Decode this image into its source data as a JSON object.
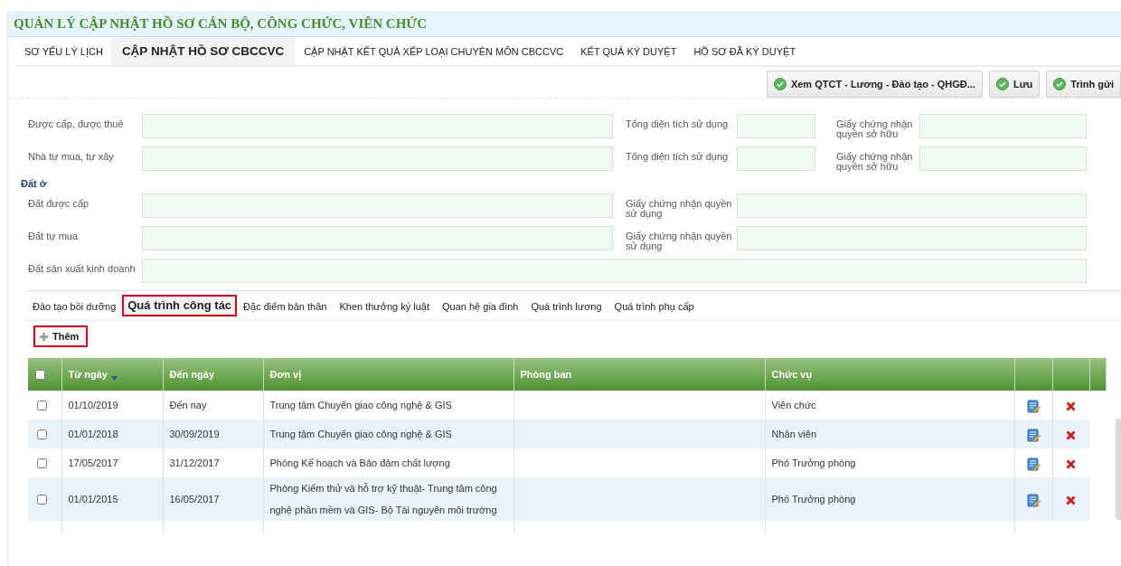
{
  "title": "QUẢN LÝ CẬP NHẬT HỒ SƠ CÁN BỘ, CÔNG CHỨC, VIÊN CHỨC",
  "tabs": [
    {
      "label": "SƠ YẾU LÝ LỊCH",
      "selected": false
    },
    {
      "label": "CẬP NHẬT HỒ SƠ CBCCVC",
      "selected": true
    },
    {
      "label": "CẬP NHẬT KẾT QUẢ XẾP LOẠI CHUYÊN MÔN CBCCVC",
      "selected": false
    },
    {
      "label": "KẾT QUẢ KÝ DUYỆT",
      "selected": false
    },
    {
      "label": "HỒ SƠ ĐÃ KÝ DUYỆT",
      "selected": false
    }
  ],
  "toolbar_buttons": [
    "Xem QTCT - Lương - Đào tạo - QHGĐ...",
    "Lưu",
    "Trình gửi"
  ],
  "housing_rows": [
    {
      "label": "Được cấp, được thuê",
      "area_label": "Tổng diện tích sử dụng",
      "cert_label": "Giấy chứng nhận quyền sở hữu"
    },
    {
      "label": "Nhà tự mua, tự xây",
      "area_label": "Tổng diện tích sử dụng",
      "cert_label": "Giấy chứng nhận quyền sở hữu"
    }
  ],
  "land": {
    "heading": "Đất ở",
    "rows": [
      {
        "label": "Đất được cấp",
        "cert_label": "Giấy chứng nhận quyền sử dụng"
      },
      {
        "label": "Đất tự mua",
        "cert_label": "Giấy chứng nhận quyền sử dụng"
      },
      {
        "label": "Đất sản xuất kinh doanh"
      }
    ]
  },
  "sub_tabs": [
    {
      "label": "Đào tạo bồi dưỡng",
      "selected": false,
      "highlighted": false
    },
    {
      "label": "Quá trình công tác",
      "selected": true,
      "highlighted": true
    },
    {
      "label": "Đặc điểm bản thân",
      "selected": false,
      "highlighted": false
    },
    {
      "label": "Khen thưởng kỷ luật",
      "selected": false,
      "highlighted": false
    },
    {
      "label": "Quan hệ gia đình",
      "selected": false,
      "highlighted": false
    },
    {
      "label": "Quá trình lương",
      "selected": false,
      "highlighted": false
    },
    {
      "label": "Quá trình phụ cấp",
      "selected": false,
      "highlighted": false
    }
  ],
  "add_button": {
    "label": "Thêm",
    "highlighted": true
  },
  "table": {
    "select_all_checked": false,
    "columns": [
      {
        "label": "Từ ngày",
        "sorted": true
      },
      {
        "label": "Đến ngày",
        "sorted": false
      },
      {
        "label": "Đơn vị",
        "sorted": false
      },
      {
        "label": "Phòng ban",
        "sorted": false
      },
      {
        "label": "Chức vụ",
        "sorted": false
      }
    ],
    "rows": [
      {
        "checked": false,
        "cells": [
          "01/10/2019",
          "Đến nay",
          "Trung tâm Chuyển giao công nghệ & GIS",
          "",
          "Viên chức"
        ]
      },
      {
        "checked": false,
        "cells": [
          "01/01/2018",
          "30/09/2019",
          "Trung tâm Chuyển giao công nghệ & GIS",
          "",
          "Nhân viên"
        ]
      },
      {
        "checked": false,
        "cells": [
          "17/05/2017",
          "31/12/2017",
          "Phòng Kế hoạch và Bảo đảm chất lượng",
          "",
          "Phó Trưởng phòng"
        ]
      },
      {
        "checked": false,
        "cells": [
          "01/01/2015",
          "16/05/2017",
          "Phòng Kiểm thử và hỗ trợ kỹ thuật- Trung tâm công nghệ phần mềm và GIS- Bộ Tài nguyên môi trường",
          "",
          "Phó Trưởng phòng"
        ]
      }
    ]
  }
}
